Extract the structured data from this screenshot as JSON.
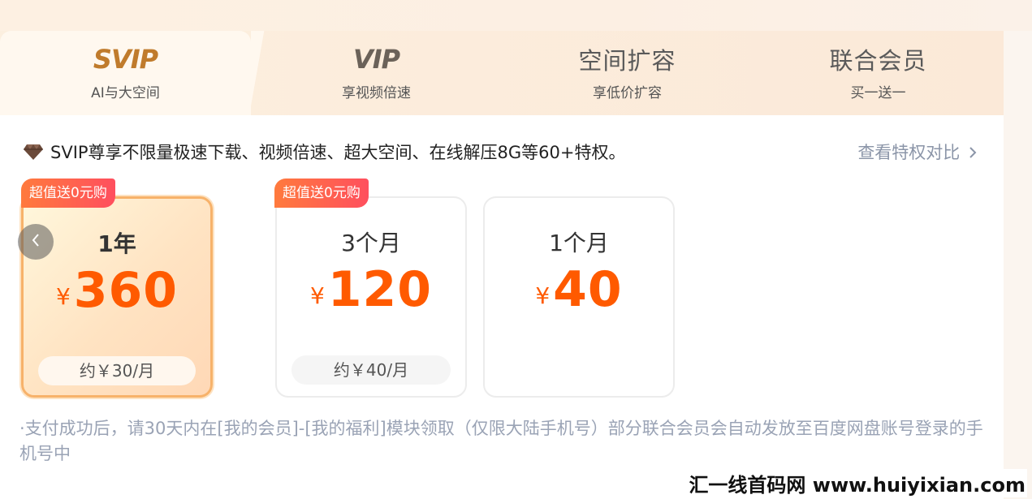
{
  "tabs": [
    {
      "title": "SVIP",
      "subtitle": "AI与大空间",
      "active": true
    },
    {
      "title": "VIP",
      "subtitle": "享视频倍速",
      "active": false
    },
    {
      "title": "空间扩容",
      "subtitle": "享低价扩容",
      "active": false
    },
    {
      "title": "联合会员",
      "subtitle": "买一送一",
      "active": false
    }
  ],
  "description": "SVIP尊享不限量极速下载、视频倍速、超大空间、在线解压8G等60+特权。",
  "compare_link": "查看特权对比",
  "plans": [
    {
      "badge": "超值送0元购",
      "period": "1年",
      "currency": "¥",
      "price": "360",
      "per_month": "约￥30/月",
      "selected": true
    },
    {
      "badge": "超值送0元购",
      "period": "3个月",
      "currency": "¥",
      "price": "120",
      "per_month": "约￥40/月",
      "selected": false
    },
    {
      "badge": "",
      "period": "1个月",
      "currency": "¥",
      "price": "40",
      "per_month": "",
      "selected": false
    }
  ],
  "note": "·支付成功后，请30天内在[我的会员]-[我的福利]模块领取（仅限大陆手机号）部分联合会员会自动发放至百度网盘账号登录的手机号中",
  "watermark": "汇一线首码网 www.huiyixian.com",
  "colors": {
    "accent": "#ff5a00",
    "badge": "#ff5a5e",
    "svip": "#c07b2c",
    "selected_border": "#f7b26a"
  }
}
